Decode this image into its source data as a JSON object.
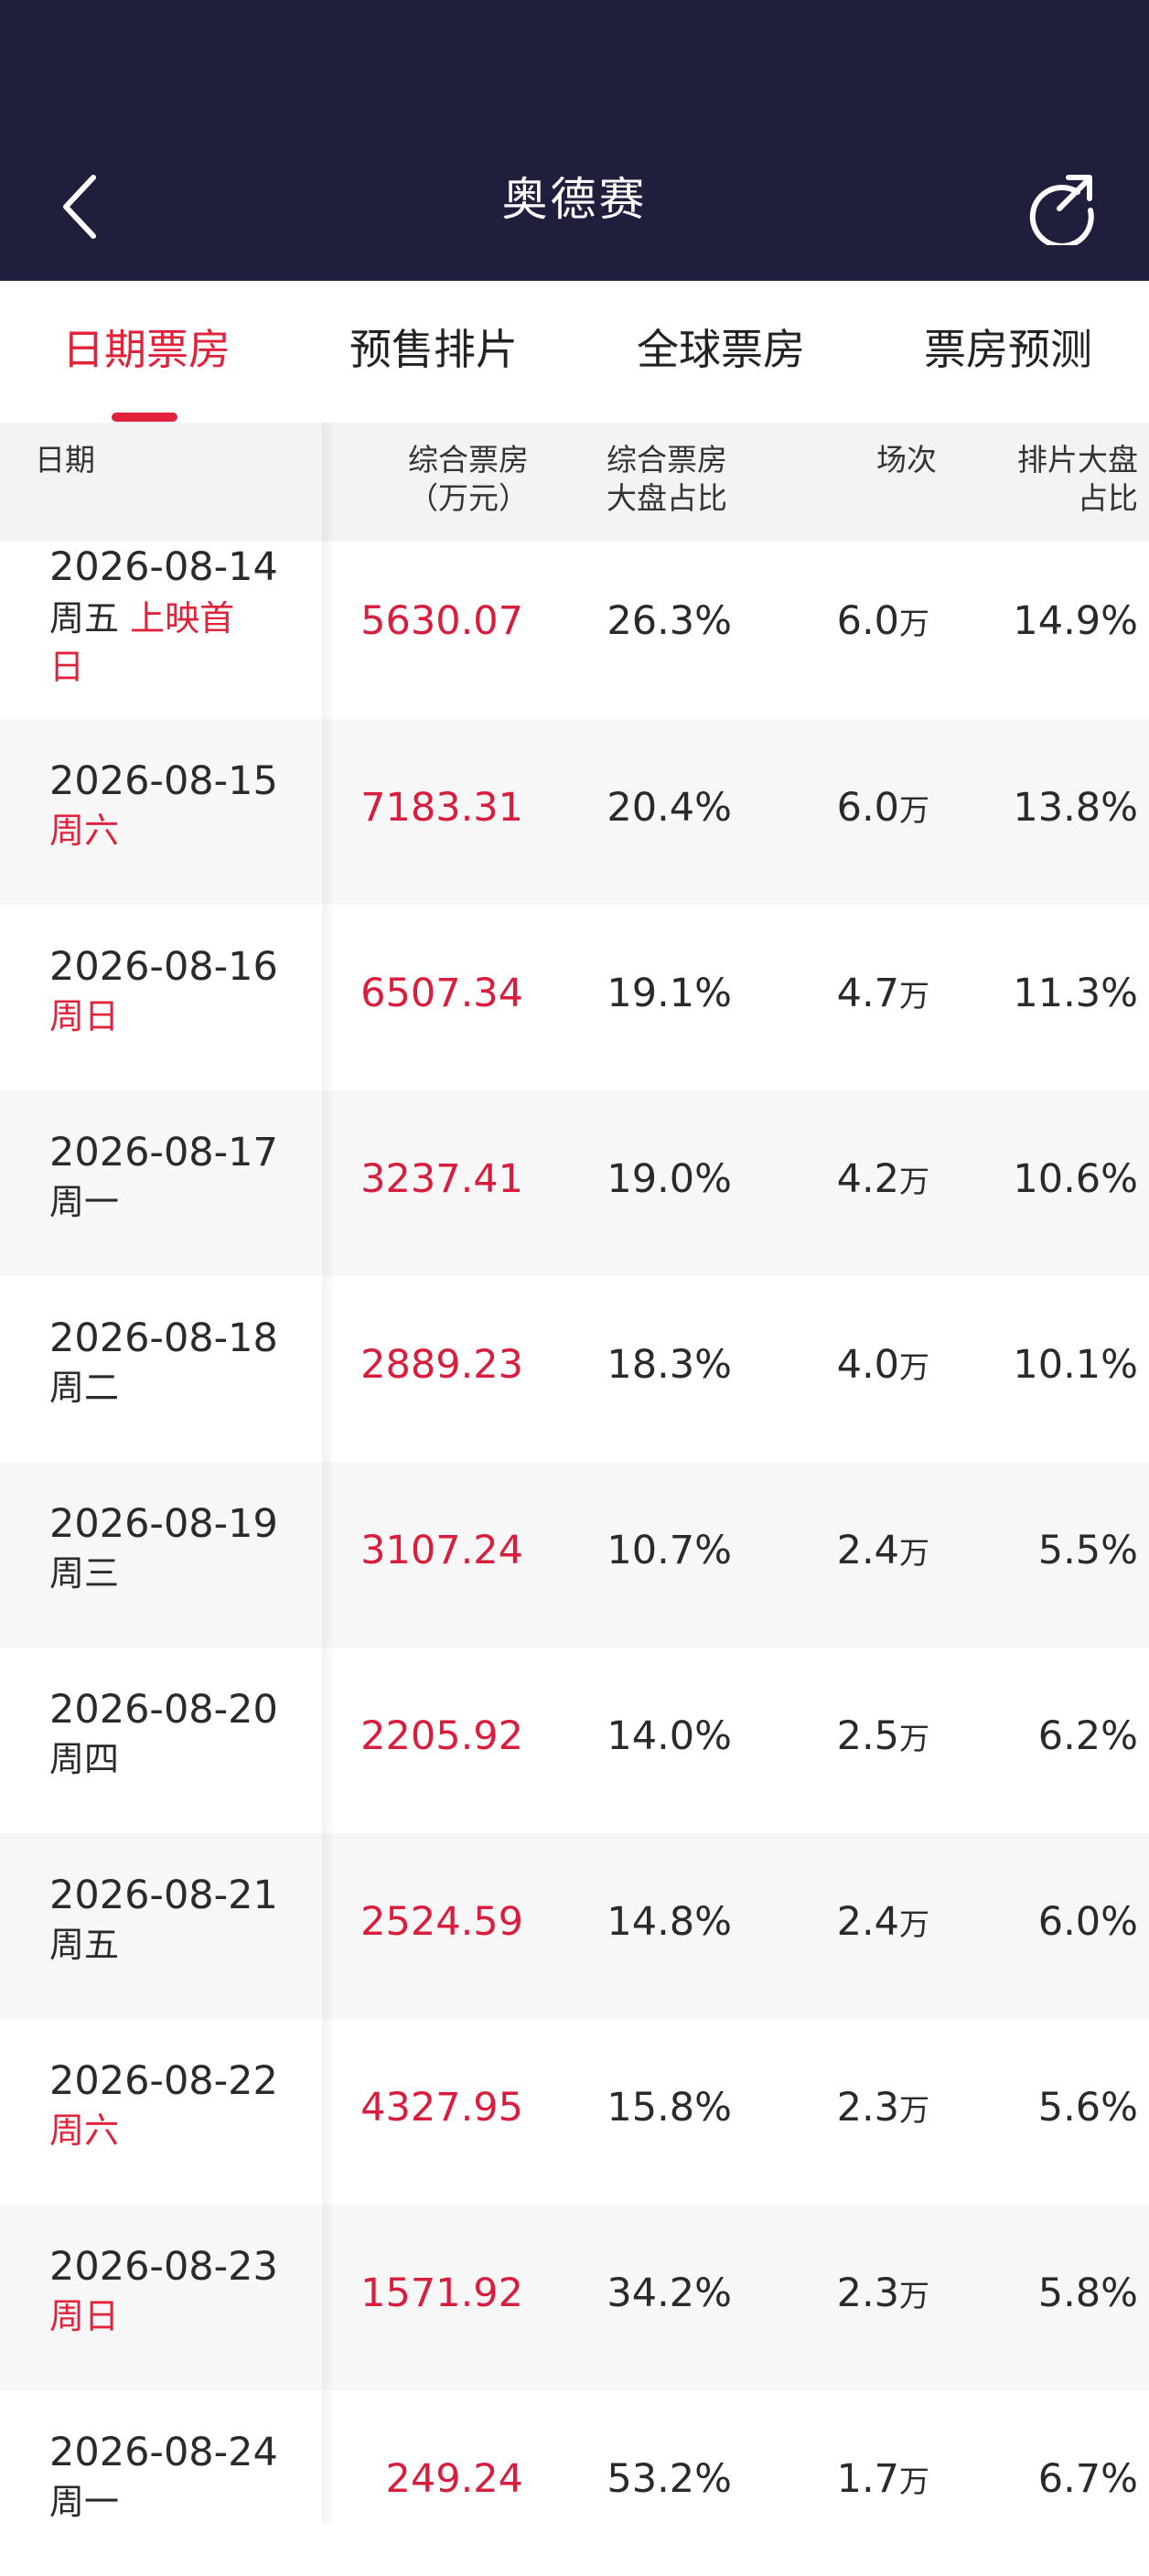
{
  "header": {
    "title": "奥德赛"
  },
  "tabs": [
    "日期票房",
    "预售排片",
    "全球票房",
    "票房预测"
  ],
  "table_header": {
    "date": "日期",
    "box_office": [
      "综合票房",
      "（万元）"
    ],
    "share": [
      "综合票房",
      "大盘占比"
    ],
    "shows": "场次",
    "schedule": [
      "排片大盘",
      "占比"
    ]
  },
  "rows": [
    {
      "date": "2026-08-14",
      "weekday": "周五",
      "note": "上映首",
      "note2": "日",
      "box": "5630.07",
      "share": "26.3%",
      "shows": "6.0",
      "shows_unit": "万",
      "sched": "14.9%"
    },
    {
      "date": "2026-08-15",
      "weekday": "周六",
      "box": "7183.31",
      "share": "20.4%",
      "shows": "6.0",
      "shows_unit": "万",
      "sched": "13.8%"
    },
    {
      "date": "2026-08-16",
      "weekday": "周日",
      "box": "6507.34",
      "share": "19.1%",
      "shows": "4.7",
      "shows_unit": "万",
      "sched": "11.3%"
    },
    {
      "date": "2026-08-17",
      "weekday": "周一",
      "box": "3237.41",
      "share": "19.0%",
      "shows": "4.2",
      "shows_unit": "万",
      "sched": "10.6%"
    },
    {
      "date": "2026-08-18",
      "weekday": "周二",
      "box": "2889.23",
      "share": "18.3%",
      "shows": "4.0",
      "shows_unit": "万",
      "sched": "10.1%"
    },
    {
      "date": "2026-08-19",
      "weekday": "周三",
      "box": "3107.24",
      "share": "10.7%",
      "shows": "2.4",
      "shows_unit": "万",
      "sched": "5.5%"
    },
    {
      "date": "2026-08-20",
      "weekday": "周四",
      "box": "2205.92",
      "share": "14.0%",
      "shows": "2.5",
      "shows_unit": "万",
      "sched": "6.2%"
    },
    {
      "date": "2026-08-21",
      "weekday": "周五",
      "box": "2524.59",
      "share": "14.8%",
      "shows": "2.4",
      "shows_unit": "万",
      "sched": "6.0%"
    },
    {
      "date": "2026-08-22",
      "weekday": "周六",
      "box": "4327.95",
      "share": "15.8%",
      "shows": "2.3",
      "shows_unit": "万",
      "sched": "5.6%"
    },
    {
      "date": "2026-08-23",
      "weekday": "周日",
      "box": "1571.92",
      "share": "34.2%",
      "shows": "2.3",
      "shows_unit": "万",
      "sched": "5.8%"
    },
    {
      "date": "2026-08-24",
      "weekday": "周一",
      "box": "249.24",
      "share": "53.2%",
      "shows": "1.7",
      "shows_unit": "万",
      "sched": "6.7%"
    }
  ]
}
